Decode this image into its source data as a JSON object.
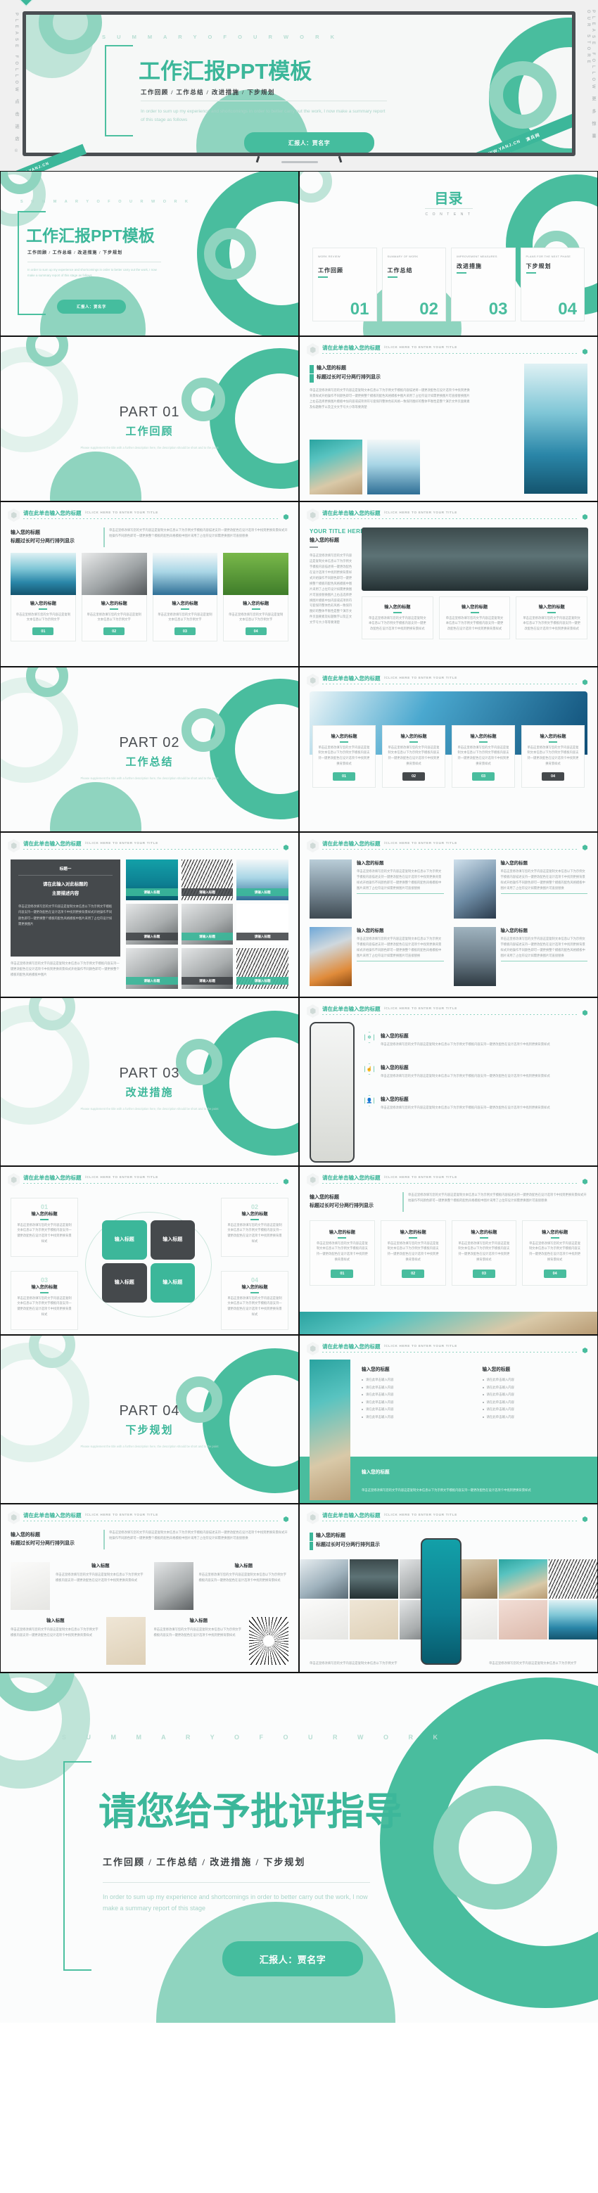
{
  "brand": {
    "accent": "#3cb79a",
    "accent_light": "#a8dccd",
    "dark": "#45494c",
    "watermark_name": "演兵网",
    "watermark_sub": "YANJ.CN"
  },
  "watermark": {
    "left_col": "PLEASE FOLLOW   点 击 进 店 ©",
    "right_col": "PLEASE FOLLOW   更 多 惊 喜 OUR STORE",
    "ribbon_bottom": "WWW.YANJ.CN",
    "ribbon_bottom2": "WWW.YANJ.CN"
  },
  "cover": {
    "eyebrow": "S U M M A R Y   O F   O U R   W O R K",
    "title": "工作汇报PPT模板",
    "subtitle": "工作回顾 / 工作总结 / 改进措施 / 下步规划",
    "description": "In order to sum up my experience and shortcomings in order to better carry out the work, I now make a summary report of this stage as follows",
    "reporter_button": "汇报人：贾名字"
  },
  "toc": {
    "title_cn": "目录",
    "title_en": "C O N T E N T",
    "items": [
      {
        "en": "WORK REVIEW",
        "cn": "工作回顾",
        "num": "01"
      },
      {
        "en": "SUMMARY OF WORK",
        "cn": "工作总结",
        "num": "02"
      },
      {
        "en": "IMPROVEMENT MEASURES",
        "cn": "改进措施",
        "num": "03"
      },
      {
        "en": "PLANS FOR THE NEXT PHASE",
        "cn": "下步规划",
        "num": "04"
      }
    ]
  },
  "content_header": {
    "title": "请在此单击输入您的标题",
    "subtitle": "/CLICK  HERE  TO  ENTER  YOUR  TITLE"
  },
  "parts": [
    {
      "no": "PART 01",
      "cn": "工作回顾",
      "en": "Please supplement the title with a further description here, the description should be short and to the point"
    },
    {
      "no": "PART 02",
      "cn": "工作总结",
      "en": "Please supplement the title with a further description here, the description should be short and to the point"
    },
    {
      "no": "PART 03",
      "cn": "改进措施",
      "en": "Please supplement the title with a further description here, the description should be short and to the point"
    },
    {
      "no": "PART 04",
      "cn": "下步规划",
      "en": "Please supplement the title with a further description here, the description should be short and to the point"
    }
  ],
  "common": {
    "title_line1": "输入您的标题",
    "title_line2": "标题过长时可分两行排列显示",
    "card_title": "输入您的标题",
    "card_title_short": "输入标题",
    "img_caption": "请输入标题",
    "bullet_text": "请在此单击输入内容",
    "your_title_here": "YOUR TITLE HERE",
    "body_long": "单击这里修改填写您的文字内容这是复制文本信息以下为示例文字模板内容描述将一键更改配色在设计选项卡中找到更换背景样式开始操作不同颜色即可一键更换整个模板的配色风格模板中图片采用了占位符设计如需更换图片可直接替换图片上右击选择更换图片模板中加内容或成项目符号套保持整体色彩风格一致保持图好的整体平衡性是整个演示文件页面要素及标题数字以及正文文字号大小等等要清楚",
    "body_med": "单击这里修改填写您的文字内容这是复制文本信息以下为示例文字模板内容描述支持一键更改配色在设计选项卡中找到更换背景样式开始操作不同颜色即可一键更换整个模板的配色风格模板中图片采用了占位符设计如需更换图片可直接替换",
    "body_short": "单击这里修改填写您的文字内容这是复制文本信息以下为示例文字模板内容支持一键更改配色在设计选项卡中找到更换背景样式",
    "body_xs": "单击这里修改填写您的文字内容这是复制文本信息以下为示例文字"
  },
  "slide_dark_panel": {
    "tag": "标题一",
    "heading_line1": "请在此输入对此标题的",
    "heading_line2": "主要描述内容",
    "body": "单击这里修改填写您的文字内容这是复制文本信息以下为示例文字模板内容支持一键更改配色在设计选项卡中找到更换背景样式开始操作不同颜色即可一键更换整个模板的配色风格模板中图片采用了占位符设计如需更换图片",
    "footer": "单击这里修改填写您的文字内容这是复制文本信息以下为示例文字模板内容支持一键更改配色在设计选项卡中找到更换背景样式开始操作不同颜色即可一键更换整个模板的配色风格模板中图片"
  },
  "cycle_diagram": {
    "center_labels": [
      "输入标题",
      "输入标题",
      "输入标题",
      "输入标题"
    ],
    "side_cards": [
      {
        "num": "01",
        "title": "输入您的标题"
      },
      {
        "num": "02",
        "title": "输入您的标题"
      },
      {
        "num": "03",
        "title": "输入您的标题"
      },
      {
        "num": "04",
        "title": "输入您的标题"
      }
    ]
  },
  "final": {
    "eyebrow": "S U M M A R Y   O F   O U R   W O R K",
    "title": "请您给予批评指导",
    "subtitle": "工作回顾 / 工作总结 / 改进措施 / 下步规划",
    "description": "In order to sum up my experience and shortcomings in order to better carry out the work, I now make a summary report of this stage",
    "reporter_button": "汇报人：贾名字"
  }
}
